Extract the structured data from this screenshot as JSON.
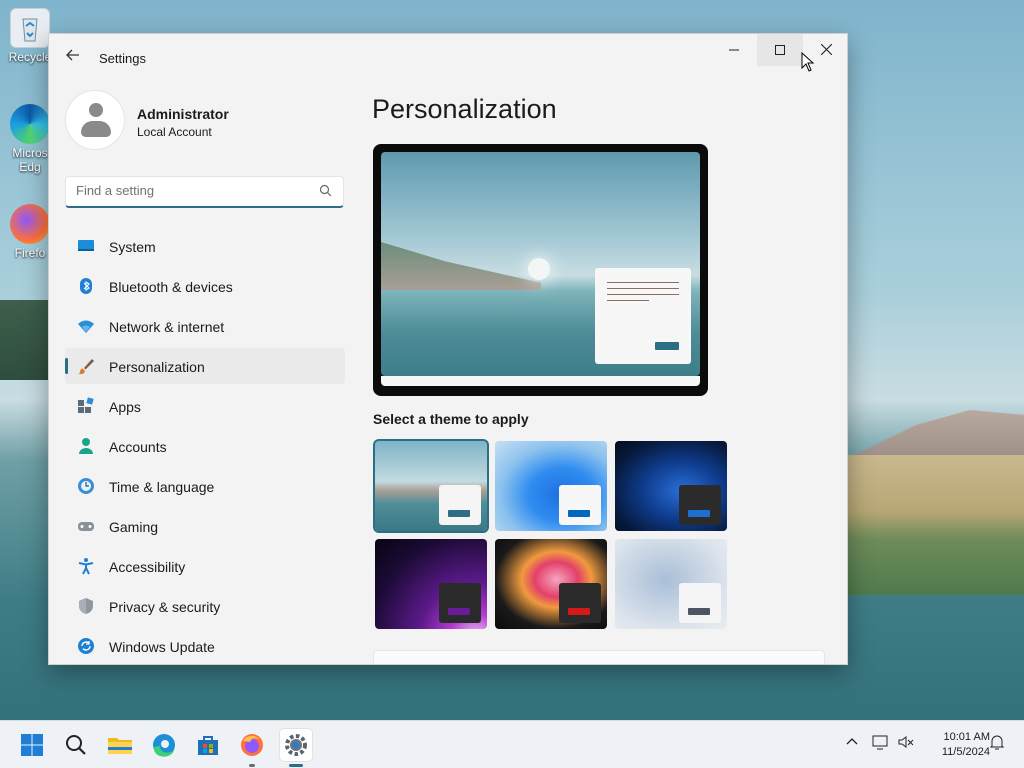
{
  "desktop": {
    "icons": [
      {
        "label": "Recycle",
        "icon": "recycle-bin-icon"
      },
      {
        "label": "Micros\nEdg",
        "icon": "edge-icon"
      },
      {
        "label": "Firefo",
        "icon": "firefox-icon"
      }
    ]
  },
  "window": {
    "title": "Settings",
    "controls": {
      "minimize": "—",
      "maximize": "☐",
      "close": "✕"
    }
  },
  "account": {
    "name": "Administrator",
    "type": "Local Account"
  },
  "search": {
    "placeholder": "Find a setting"
  },
  "nav": {
    "items": [
      {
        "label": "System",
        "icon": "system-icon"
      },
      {
        "label": "Bluetooth & devices",
        "icon": "bluetooth-icon"
      },
      {
        "label": "Network & internet",
        "icon": "wifi-icon"
      },
      {
        "label": "Personalization",
        "icon": "brush-icon",
        "active": true
      },
      {
        "label": "Apps",
        "icon": "apps-icon"
      },
      {
        "label": "Accounts",
        "icon": "person-icon"
      },
      {
        "label": "Time & language",
        "icon": "clock-globe-icon"
      },
      {
        "label": "Gaming",
        "icon": "gamepad-icon"
      },
      {
        "label": "Accessibility",
        "icon": "accessibility-icon"
      },
      {
        "label": "Privacy & security",
        "icon": "shield-icon"
      },
      {
        "label": "Windows Update",
        "icon": "update-icon"
      }
    ]
  },
  "main": {
    "title": "Personalization",
    "themes_label": "Select a theme to apply",
    "themes": [
      {
        "name": "windows-spotlight-lake",
        "selected": true,
        "accent": "#2c6e84"
      },
      {
        "name": "windows-light",
        "selected": false,
        "accent": "#0067c0"
      },
      {
        "name": "windows-dark",
        "selected": false,
        "accent": "#1e6fd0"
      },
      {
        "name": "glow",
        "selected": false,
        "accent": "#6a1b9a"
      },
      {
        "name": "captured-motion",
        "selected": false,
        "accent": "#d31919"
      },
      {
        "name": "flow",
        "selected": false,
        "accent": "#4b5563"
      }
    ]
  },
  "taskbar": {
    "apps": [
      "start-icon",
      "search-icon",
      "file-explorer-icon",
      "edge-icon",
      "store-icon",
      "firefox-icon",
      "settings-icon"
    ],
    "time": "10:01 AM",
    "date": "11/5/2024"
  },
  "colors": {
    "accent": "#2c6e84"
  }
}
